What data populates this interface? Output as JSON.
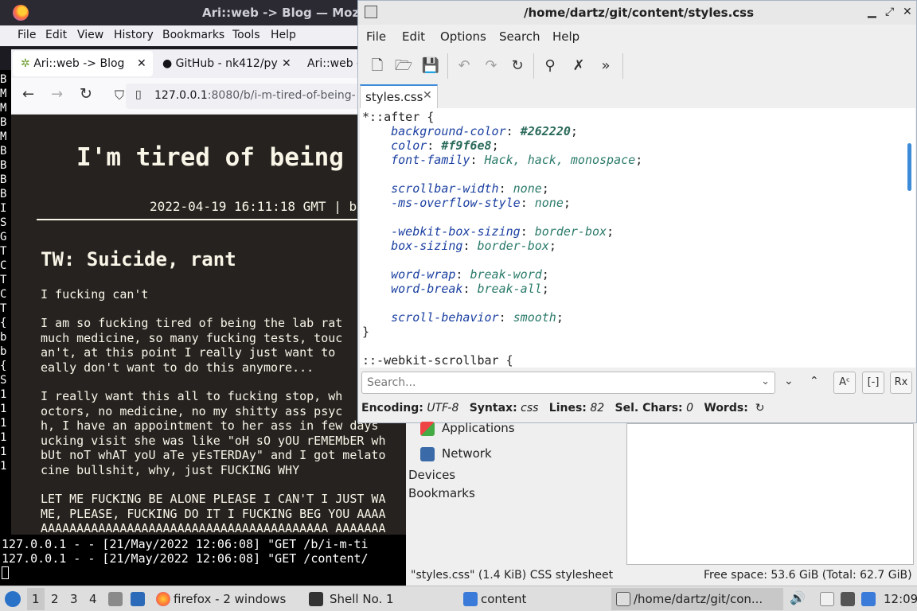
{
  "terminal": {
    "left_column": [
      "B",
      "M",
      "M",
      "B",
      "M",
      "B",
      "B",
      "B",
      "B",
      "I",
      "S",
      "G",
      "T",
      "C",
      "T",
      "C",
      "T",
      "",
      "{",
      "b",
      "b",
      "",
      "{",
      "S",
      "1",
      "1",
      "1",
      "1",
      "1",
      "1"
    ],
    "bottom_lines": [
      "127.0.0.1 - - [21/May/2022 12:06:08] \"GET /b/i-m-ti",
      "127.0.0.1 - - [21/May/2022 12:06:08] \"GET /content/"
    ]
  },
  "firefox": {
    "title": "Ari::web -> Blog — Moz",
    "menu": [
      "File",
      "Edit",
      "View",
      "History",
      "Bookmarks",
      "Tools",
      "Help"
    ],
    "tabs": [
      {
        "label": "Ari::web -> Blog",
        "close": "✕"
      },
      {
        "label": "GitHub - nk412/py",
        "close": "✕"
      },
      {
        "label": "Ari::web -",
        "close": ""
      }
    ],
    "url_host": "127.0.0.1",
    "url_rest": ":8080/b/i-m-tired-of-being-",
    "blog": {
      "title": "I'm tired of being",
      "date": "2022-04-19 16:11:18 GMT | b",
      "heading": "TW: Suicide, rant",
      "p1": "I fucking can't",
      "p2": "I am so fucking tired of being the lab rat\nmuch medicine, so many fucking tests, touc\nan't, at this point I really just want to\neally don't want to do this anymore...",
      "p3": "I really want this all to fucking stop, wh\noctors, no medicine, no my shitty ass psyc\nh, I have an appointment to her ass in few days\nucking visit she was like \"oH sO yOU rEMEMbER wh\nbUt noT whAT yoU aTe yEsTERDAy\" and I got melato\ncine bullshit, why, just FUCKING WHY",
      "p4": "LET ME FUCKING BE ALONE PLEASE I CAN'T I JUST WA\nME, PLEASE, FUCKING DO IT I FUCKING BEG YOU AAAA\nAAAAAAAAAAAAAAAAAAAAAAAAAAAAAAAAAAAAAAAA AAAAAAA"
    }
  },
  "editor": {
    "title": "/home/dartz/git/content/styles.css",
    "menu": [
      "File",
      "Edit",
      "Options",
      "Search",
      "Help"
    ],
    "tab_label": "styles.css",
    "code": {
      "l1": "*::after {",
      "bg_prop": "background-color",
      "bg_val": "#262220",
      "color_prop": "color",
      "color_val": "#f9f6e8",
      "font_prop": "font-family",
      "font_val": "Hack, hack, monospace",
      "sw_prop": "scrollbar-width",
      "sw_val": "none",
      "ms_prop": "-ms-overflow-style",
      "ms_val": "none",
      "wbs_prop": "-webkit-box-sizing",
      "wbs_val": "border-box",
      "bs_prop": "box-sizing",
      "bs_val": "border-box",
      "ww_prop": "word-wrap",
      "ww_val": "break-word",
      "wb_prop": "word-break",
      "wb_val": "break-all",
      "sb_prop": "scroll-behavior",
      "sb_val": "smooth",
      "close": "}",
      "l2": "::-webkit-scrollbar {"
    },
    "search_placeholder": "Search...",
    "status": {
      "enc_label": "Encoding:",
      "enc": "UTF-8",
      "syn_label": "Syntax:",
      "syn": "css",
      "lines_label": "Lines:",
      "lines": "82",
      "sel_label": "Sel. Chars:",
      "sel": "0",
      "words_label": "Words:"
    }
  },
  "filemanager": {
    "items": [
      "Applications",
      "Network"
    ],
    "sections": [
      "Devices",
      "Bookmarks"
    ],
    "status_left": "\"styles.css\" (1.4 KiB) CSS stylesheet",
    "status_right": "Free space: 53.6 GiB (Total: 62.7 GiB)"
  },
  "taskbar": {
    "desktops": [
      "1",
      "2",
      "3",
      "4"
    ],
    "firefox": "firefox - 2 windows",
    "shell": "Shell No. 1",
    "content": "content",
    "editor": "/home/dartz/git/con...",
    "time": "12:09"
  },
  "colors": {
    "accent": "#3c8ad8",
    "blog_bg": "#262220",
    "blog_fg": "#f9f6e8"
  }
}
